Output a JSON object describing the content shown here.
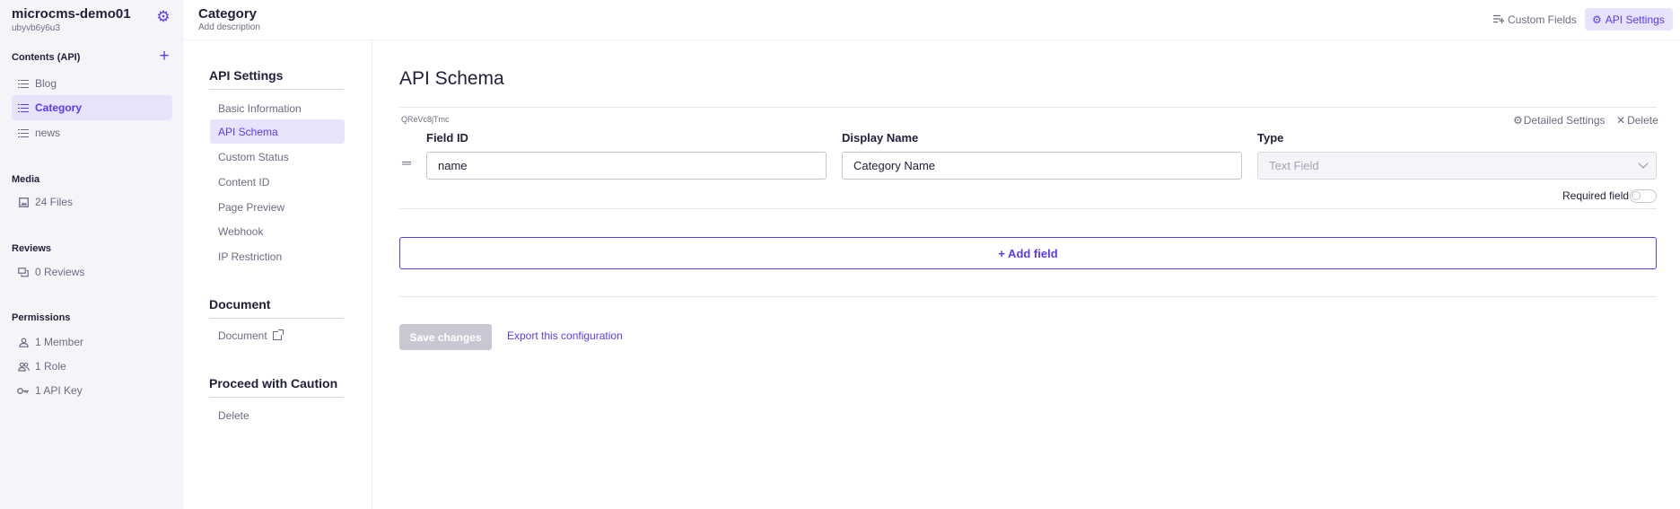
{
  "sidebar": {
    "workspace_name": "microcms-demo01",
    "workspace_id": "ubyvb6y6u3",
    "contents_label": "Contents (API)",
    "contents_items": [
      {
        "label": "Blog"
      },
      {
        "label": "Category"
      },
      {
        "label": "news"
      }
    ],
    "media_label": "Media",
    "media_item": "24 Files",
    "reviews_label": "Reviews",
    "reviews_item": "0 Reviews",
    "permissions_label": "Permissions",
    "permissions_items": [
      {
        "label": "1 Member"
      },
      {
        "label": "1 Role"
      },
      {
        "label": "1 API Key"
      }
    ]
  },
  "header": {
    "title": "Category",
    "description": "Add description",
    "custom_fields_label": "Custom Fields",
    "api_settings_label": "API Settings"
  },
  "settings_nav": {
    "api_settings_heading": "API Settings",
    "items": [
      {
        "label": "Basic Information"
      },
      {
        "label": "API Schema"
      },
      {
        "label": "Custom Status"
      },
      {
        "label": "Content ID"
      },
      {
        "label": "Page Preview"
      },
      {
        "label": "Webhook"
      },
      {
        "label": "IP Restriction"
      }
    ],
    "document_heading": "Document",
    "document_item": "Document",
    "caution_heading": "Proceed with Caution",
    "delete_item": "Delete"
  },
  "main": {
    "title": "API Schema",
    "field": {
      "code": "QReVc8jTmc",
      "detailed_settings": "Detailed Settings",
      "delete": "Delete",
      "field_id_label": "Field ID",
      "field_id_value": "name",
      "display_name_label": "Display Name",
      "display_name_value": "Category Name",
      "type_label": "Type",
      "type_value": "Text Field",
      "required_label": "Required field",
      "required": false
    },
    "add_field_label": "+ Add field",
    "save_label": "Save changes",
    "export_label": "Export this configuration"
  },
  "colors": {
    "accent": "#563bff",
    "active_bg": "#e6e3fa",
    "sidebar_bg": "#f5f5f9"
  }
}
